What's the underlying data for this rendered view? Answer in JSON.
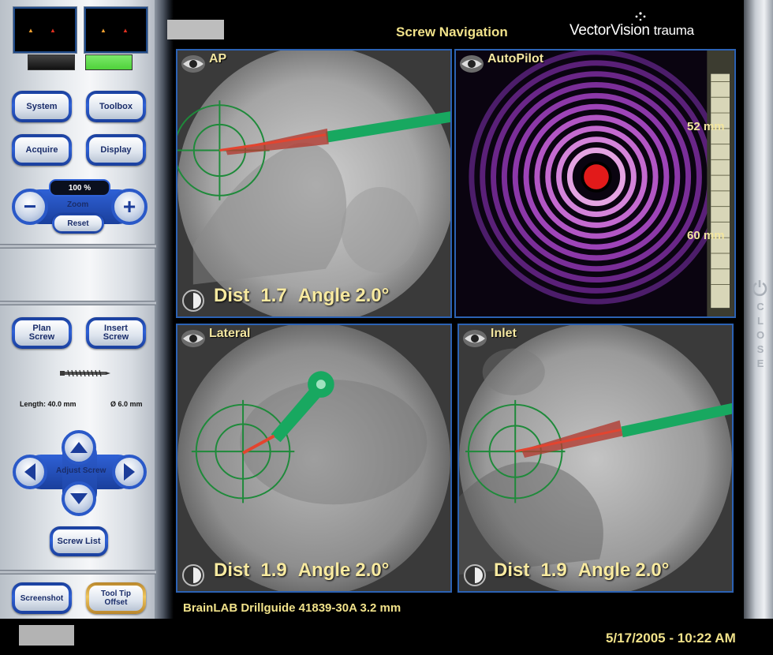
{
  "header": {
    "title": "Screw Navigation",
    "brand_main": "VectorVision",
    "brand_sub": "trauma"
  },
  "sidebar": {
    "buttons": {
      "system": "System",
      "toolbox": "Toolbox",
      "acquire": "Acquire",
      "display": "Display",
      "plan_screw": "Plan Screw",
      "insert_screw": "Insert Screw",
      "screw_list": "Screw List",
      "screenshot": "Screenshot",
      "tool_tip_offset": "Tool Tip Offset"
    },
    "zoom": {
      "value": "100 %",
      "label": "Zoom",
      "reset": "Reset",
      "minus": "−",
      "plus": "+"
    },
    "screw": {
      "length": "Length: 40.0 mm",
      "diameter": "Ø 6.0 mm",
      "adjust_label": "Adjust Screw"
    },
    "indicators": {
      "left_color": "#444444",
      "right_color": "#4fd23a"
    }
  },
  "views": {
    "ap": {
      "title": "AP",
      "dist_label": "Dist",
      "dist_value": "1.7",
      "angle_label": "Angle",
      "angle_value": "2.0°"
    },
    "autopilot": {
      "title": "AutoPilot",
      "scale_top": "52 mm",
      "scale_bottom": "60 mm"
    },
    "lateral": {
      "title": "Lateral",
      "dist_label": "Dist",
      "dist_value": "1.9",
      "angle_label": "Angle",
      "angle_value": "2.0°"
    },
    "inlet": {
      "title": "Inlet",
      "dist_label": "Dist",
      "dist_value": "1.9",
      "angle_label": "Angle",
      "angle_value": "2.0°"
    }
  },
  "footer": {
    "tool": "BrainLAB Drillguide 41839-30A 3.2 mm",
    "datetime": "5/17/2005 - 10:22 AM"
  },
  "right_bar": {
    "close": "CLOSE"
  },
  "colors": {
    "accent_text": "#f1e28a",
    "button_blue": "#2f61d6",
    "pane_border": "#2c62b4",
    "target_green": "#1e8a3a",
    "tool_green": "#18a860",
    "screw_red": "#c8342a"
  }
}
